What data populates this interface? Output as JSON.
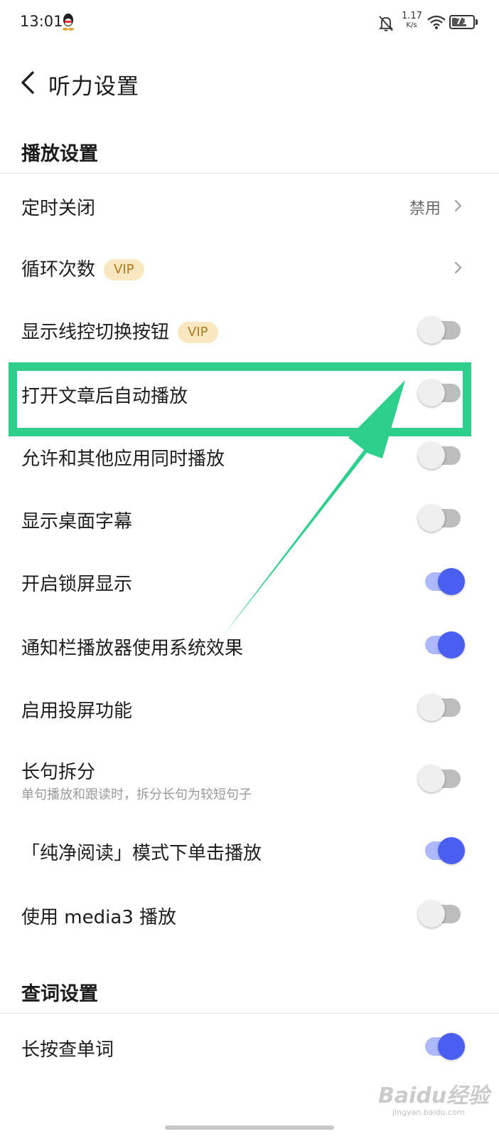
{
  "status_bar": {
    "time": "13:01",
    "net_speed_value": "1.17",
    "net_speed_unit": "K/s",
    "battery": "71",
    "battery_level": 0.71,
    "icons": [
      "qq-icon",
      "bell-off-icon",
      "wifi-icon",
      "battery-icon"
    ]
  },
  "header": {
    "title": "听力设置",
    "back_icon": "chevron-left-icon"
  },
  "sections": {
    "playback": {
      "title": "播放设置"
    },
    "lookup": {
      "title": "查词设置"
    }
  },
  "rows": {
    "sleep_timer": {
      "label": "定时关闭",
      "value": "禁用"
    },
    "loop_count": {
      "label": "循环次数",
      "badge": "VIP"
    },
    "show_wire_control": {
      "label": "显示线控切换按钮",
      "badge": "VIP",
      "on": false
    },
    "auto_play": {
      "label": "打开文章后自动播放",
      "on": false
    },
    "mix_with_others": {
      "label": "允许和其他应用同时播放",
      "on": false
    },
    "desktop_subtitles": {
      "label": "显示桌面字幕",
      "on": false
    },
    "lock_screen_display": {
      "label": "开启锁屏显示",
      "on": true
    },
    "system_notification": {
      "label": "通知栏播放器使用系统效果",
      "on": true
    },
    "cast": {
      "label": "启用投屏功能",
      "on": false
    },
    "split_sentences": {
      "label": "长句拆分",
      "sublabel": "单句播放和跟读时，拆分长句为较短句子",
      "on": false
    },
    "clean_read_tap": {
      "label": "「纯净阅读」模式下单击播放",
      "on": true
    },
    "media3": {
      "label": "使用 media3 播放",
      "on": false
    },
    "long_press_lookup": {
      "label": "长按查单词",
      "on": true
    }
  },
  "colors": {
    "accent": "#4a5ff0",
    "accent_track": "#aeb9fb",
    "toggle_off_track": "#bdbdbd",
    "vip_bg": "#f9e7c0",
    "vip_text": "#b07a1f",
    "annotation": "#2ecf8c"
  },
  "watermark": {
    "main": "Baidu经验",
    "sub": "jingyan.baidu.com"
  }
}
